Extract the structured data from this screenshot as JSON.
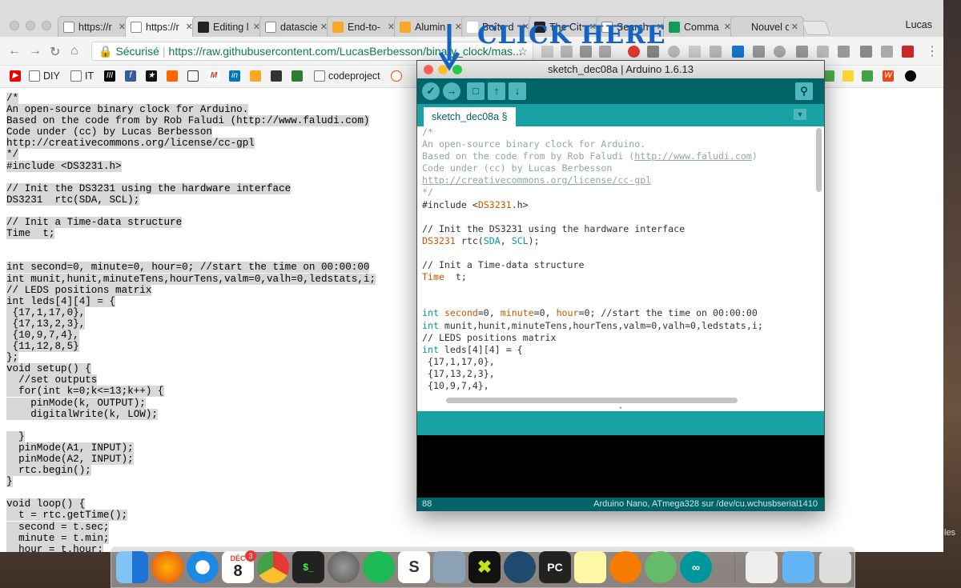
{
  "browser": {
    "tabs": [
      {
        "label": "https://r",
        "icon": "page-icon"
      },
      {
        "label": "https://r",
        "icon": "page-icon",
        "active": true
      },
      {
        "label": "Editing l",
        "icon": "github-icon"
      },
      {
        "label": "datascie",
        "icon": "loading-icon"
      },
      {
        "label": "End-to-",
        "icon": "doc-icon"
      },
      {
        "label": "Alumin",
        "icon": "doc-icon"
      },
      {
        "label": "Boîte d",
        "icon": "gmail-icon"
      },
      {
        "label": "The Cit",
        "icon": "news-icon"
      },
      {
        "label": "Search r",
        "icon": "search-icon"
      },
      {
        "label": "Comma",
        "icon": "sheets-icon"
      },
      {
        "label": "Nouvel ong",
        "icon": "newtab-icon"
      }
    ],
    "profile": "Lucas",
    "address": {
      "secure_label": "Sécurisé",
      "url": "https://raw.githubusercontent.com/LucasBerbesson/binary_clock/mas..."
    },
    "bookmarks": [
      "DIY",
      "IT",
      "codeproject"
    ]
  },
  "raw_code": [
    "/*",
    "An open-source binary clock for Arduino.",
    "Based on the code from by Rob Faludi (http://www.faludi.com)",
    "Code under (cc) by Lucas Berbesson",
    "http://creativecommons.org/license/cc-gpl",
    "*/",
    "#include <DS3231.h>",
    "",
    "// Init the DS3231 using the hardware interface",
    "DS3231  rtc(SDA, SCL);",
    "",
    "// Init a Time-data structure",
    "Time  t;",
    "",
    "",
    "int second=0, minute=0, hour=0; //start the time on 00:00:00",
    "int munit,hunit,minuteTens,hourTens,valm=0,valh=0,ledstats,i;",
    "// LEDS positions matrix",
    "int leds[4][4] = {",
    " {17,1,17,0},",
    " {17,13,2,3},",
    " {10,9,7,4},",
    " {11,12,8,5}",
    "};",
    "void setup() {",
    "  //set outputs",
    "  for(int k=0;k<=13;k++) {",
    "    pinMode(k, OUTPUT);",
    "    digitalWrite(k, LOW);",
    "",
    "  }",
    "  pinMode(A1, INPUT);",
    "  pinMode(A2, INPUT);",
    "  rtc.begin();",
    "}",
    "",
    "void loop() {",
    "  t = rtc.getTime();",
    "  second = t.sec;",
    "  minute = t.min;",
    "  hour = t.hour;"
  ],
  "arduino": {
    "title": "sketch_dec08a | Arduino 1.6.13",
    "tab": "sketch_dec08a §",
    "footer_left": "88",
    "footer_right": "Arduino Nano, ATmega328 sur /dev/cu.wchusbserial1410",
    "code": [
      [
        [
          "cm",
          "/*"
        ]
      ],
      [
        [
          "cm",
          "An open-source binary clock for Arduino."
        ]
      ],
      [
        [
          "cm",
          "Based on the code from by Rob Faludi ("
        ],
        [
          "cm lnk",
          "http://www.faludi.com"
        ],
        [
          "cm",
          ")"
        ]
      ],
      [
        [
          "cm",
          "Code under (cc) by Lucas Berbesson"
        ]
      ],
      [
        [
          "cm lnk",
          "http://creativecommons.org/license/cc-gpl"
        ]
      ],
      [
        [
          "cm",
          "*/"
        ]
      ],
      [
        [
          "",
          "#include <"
        ],
        [
          "ty",
          "DS3231"
        ],
        [
          "",
          ".h>"
        ]
      ],
      [
        [
          "",
          ""
        ]
      ],
      [
        [
          "",
          "// Init the DS3231 using the hardware interface"
        ]
      ],
      [
        [
          "ty",
          "DS3231"
        ],
        [
          "",
          " rtc("
        ],
        [
          "kw",
          "SDA"
        ],
        [
          "",
          ", "
        ],
        [
          "kw",
          "SCL"
        ],
        [
          "",
          ");"
        ]
      ],
      [
        [
          "",
          ""
        ]
      ],
      [
        [
          "",
          "// Init a Time-data structure"
        ]
      ],
      [
        [
          "ty",
          "Time"
        ],
        [
          "",
          "  t;"
        ]
      ],
      [
        [
          "",
          ""
        ]
      ],
      [
        [
          "",
          ""
        ]
      ],
      [
        [
          "kw",
          "int"
        ],
        [
          "",
          " "
        ],
        [
          "ty",
          "second"
        ],
        [
          "",
          "=0, "
        ],
        [
          "ty",
          "minute"
        ],
        [
          "",
          "=0, "
        ],
        [
          "ty",
          "hour"
        ],
        [
          "",
          "=0; //start the time on 00:00:00"
        ]
      ],
      [
        [
          "kw",
          "int"
        ],
        [
          "",
          " munit,hunit,minuteTens,hourTens,valm=0,valh=0,ledstats,i;"
        ]
      ],
      [
        [
          "",
          "// LEDS positions matrix"
        ]
      ],
      [
        [
          "kw",
          "int"
        ],
        [
          "",
          " leds[4][4] = {"
        ]
      ],
      [
        [
          "",
          " {17,1,17,0},"
        ]
      ],
      [
        [
          "",
          " {17,13,2,3},"
        ]
      ],
      [
        [
          "",
          " {10,9,7,4},"
        ]
      ]
    ]
  },
  "annotation": "CLICK HERE",
  "dock": {
    "calendar_month": "DÉC",
    "calendar_day": "8",
    "badge": "3"
  },
  "side_text": "les"
}
